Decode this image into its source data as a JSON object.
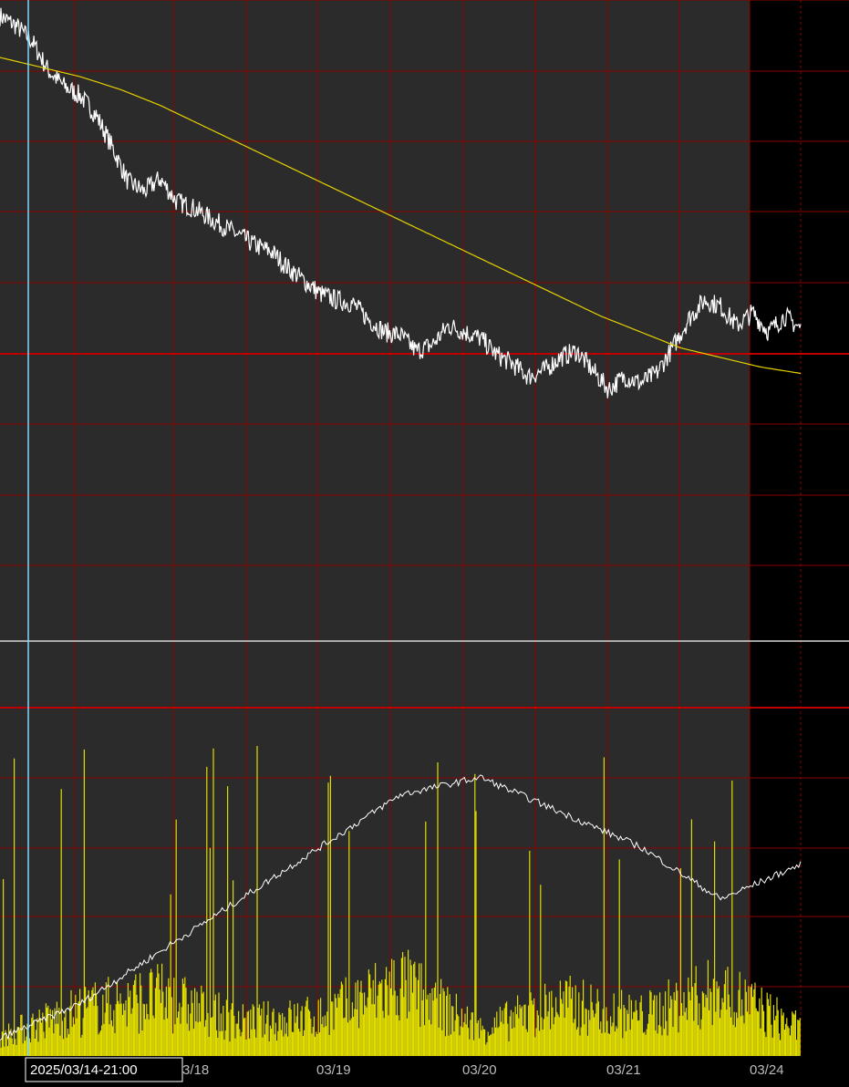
{
  "chart_data": {
    "type": "line",
    "x_ticks": [
      "3/18",
      "03/19",
      "03/20",
      "03/21",
      "03/24"
    ],
    "cursor_label": "2025/03/14-21:00",
    "grid": true,
    "legend": "none",
    "colors": {
      "background_session": "#2b2b2b",
      "background_after_hours": "#000000",
      "grid": "#8b0000",
      "price_line": "#ffffff",
      "average_line": "#e6d200",
      "volume_bars": "#e0dc00",
      "cursor_line": "#7fd8ff",
      "reference_line": "#c00000"
    },
    "price_panel": {
      "series": [
        {
          "x": [
            0,
            0.02,
            0.04,
            0.06,
            0.08,
            0.1,
            0.12,
            0.14,
            0.16,
            0.18,
            0.2,
            0.22,
            0.24,
            0.26,
            0.28,
            0.3,
            0.32,
            0.34,
            0.36,
            0.38,
            0.4,
            0.42,
            0.44,
            0.46,
            0.48,
            0.5,
            0.52,
            0.54,
            0.56,
            0.58,
            0.6,
            0.62,
            0.64,
            0.66,
            0.68,
            0.7,
            0.72,
            0.74,
            0.76,
            0.78,
            0.8,
            0.82,
            0.84,
            0.86,
            0.88,
            0.9,
            0.92,
            0.94,
            0.96,
            0.98,
            1.0
          ],
          "y": [
            97.5,
            96.0,
            93.5,
            89.0,
            86.5,
            85.0,
            82.0,
            77.0,
            71.5,
            70.0,
            72.0,
            68.5,
            67.5,
            66.0,
            64.5,
            63.0,
            61.5,
            60.5,
            58.0,
            56.0,
            54.0,
            53.0,
            52.5,
            50.0,
            48.0,
            47.5,
            45.0,
            46.0,
            49.0,
            48.0,
            47.0,
            44.5,
            43.0,
            41.0,
            42.0,
            44.0,
            45.0,
            42.0,
            39.0,
            41.0,
            40.0,
            41.5,
            45.5,
            50.0,
            53.0,
            52.0,
            49.0,
            51.0,
            48.0,
            50.5,
            48.5
          ]
        },
        {
          "x": [
            0,
            0.05,
            0.1,
            0.15,
            0.2,
            0.25,
            0.3,
            0.35,
            0.4,
            0.45,
            0.5,
            0.55,
            0.6,
            0.65,
            0.7,
            0.75,
            0.8,
            0.85,
            0.9,
            0.95,
            1.0
          ],
          "y": [
            91.0,
            89.5,
            88.0,
            86.0,
            83.5,
            80.5,
            77.5,
            74.5,
            71.5,
            68.5,
            65.5,
            62.5,
            59.5,
            56.5,
            53.5,
            50.5,
            48.0,
            45.5,
            44.0,
            42.5,
            41.5
          ]
        }
      ]
    },
    "volume_panel": {
      "series": [
        {
          "x": [
            0,
            0.1,
            0.2,
            0.3,
            0.4,
            0.5,
            0.6,
            0.7,
            0.8,
            0.9,
            1.0
          ],
          "y": [
            15,
            35,
            45,
            25,
            30,
            55,
            20,
            40,
            30,
            50,
            20
          ]
        },
        {
          "x": [
            0,
            0.1,
            0.2,
            0.3,
            0.4,
            0.5,
            0.6,
            0.7,
            0.8,
            0.9,
            1.0
          ],
          "y": [
            5,
            15,
            30,
            45,
            60,
            75,
            80,
            70,
            60,
            45,
            55
          ]
        }
      ]
    }
  }
}
